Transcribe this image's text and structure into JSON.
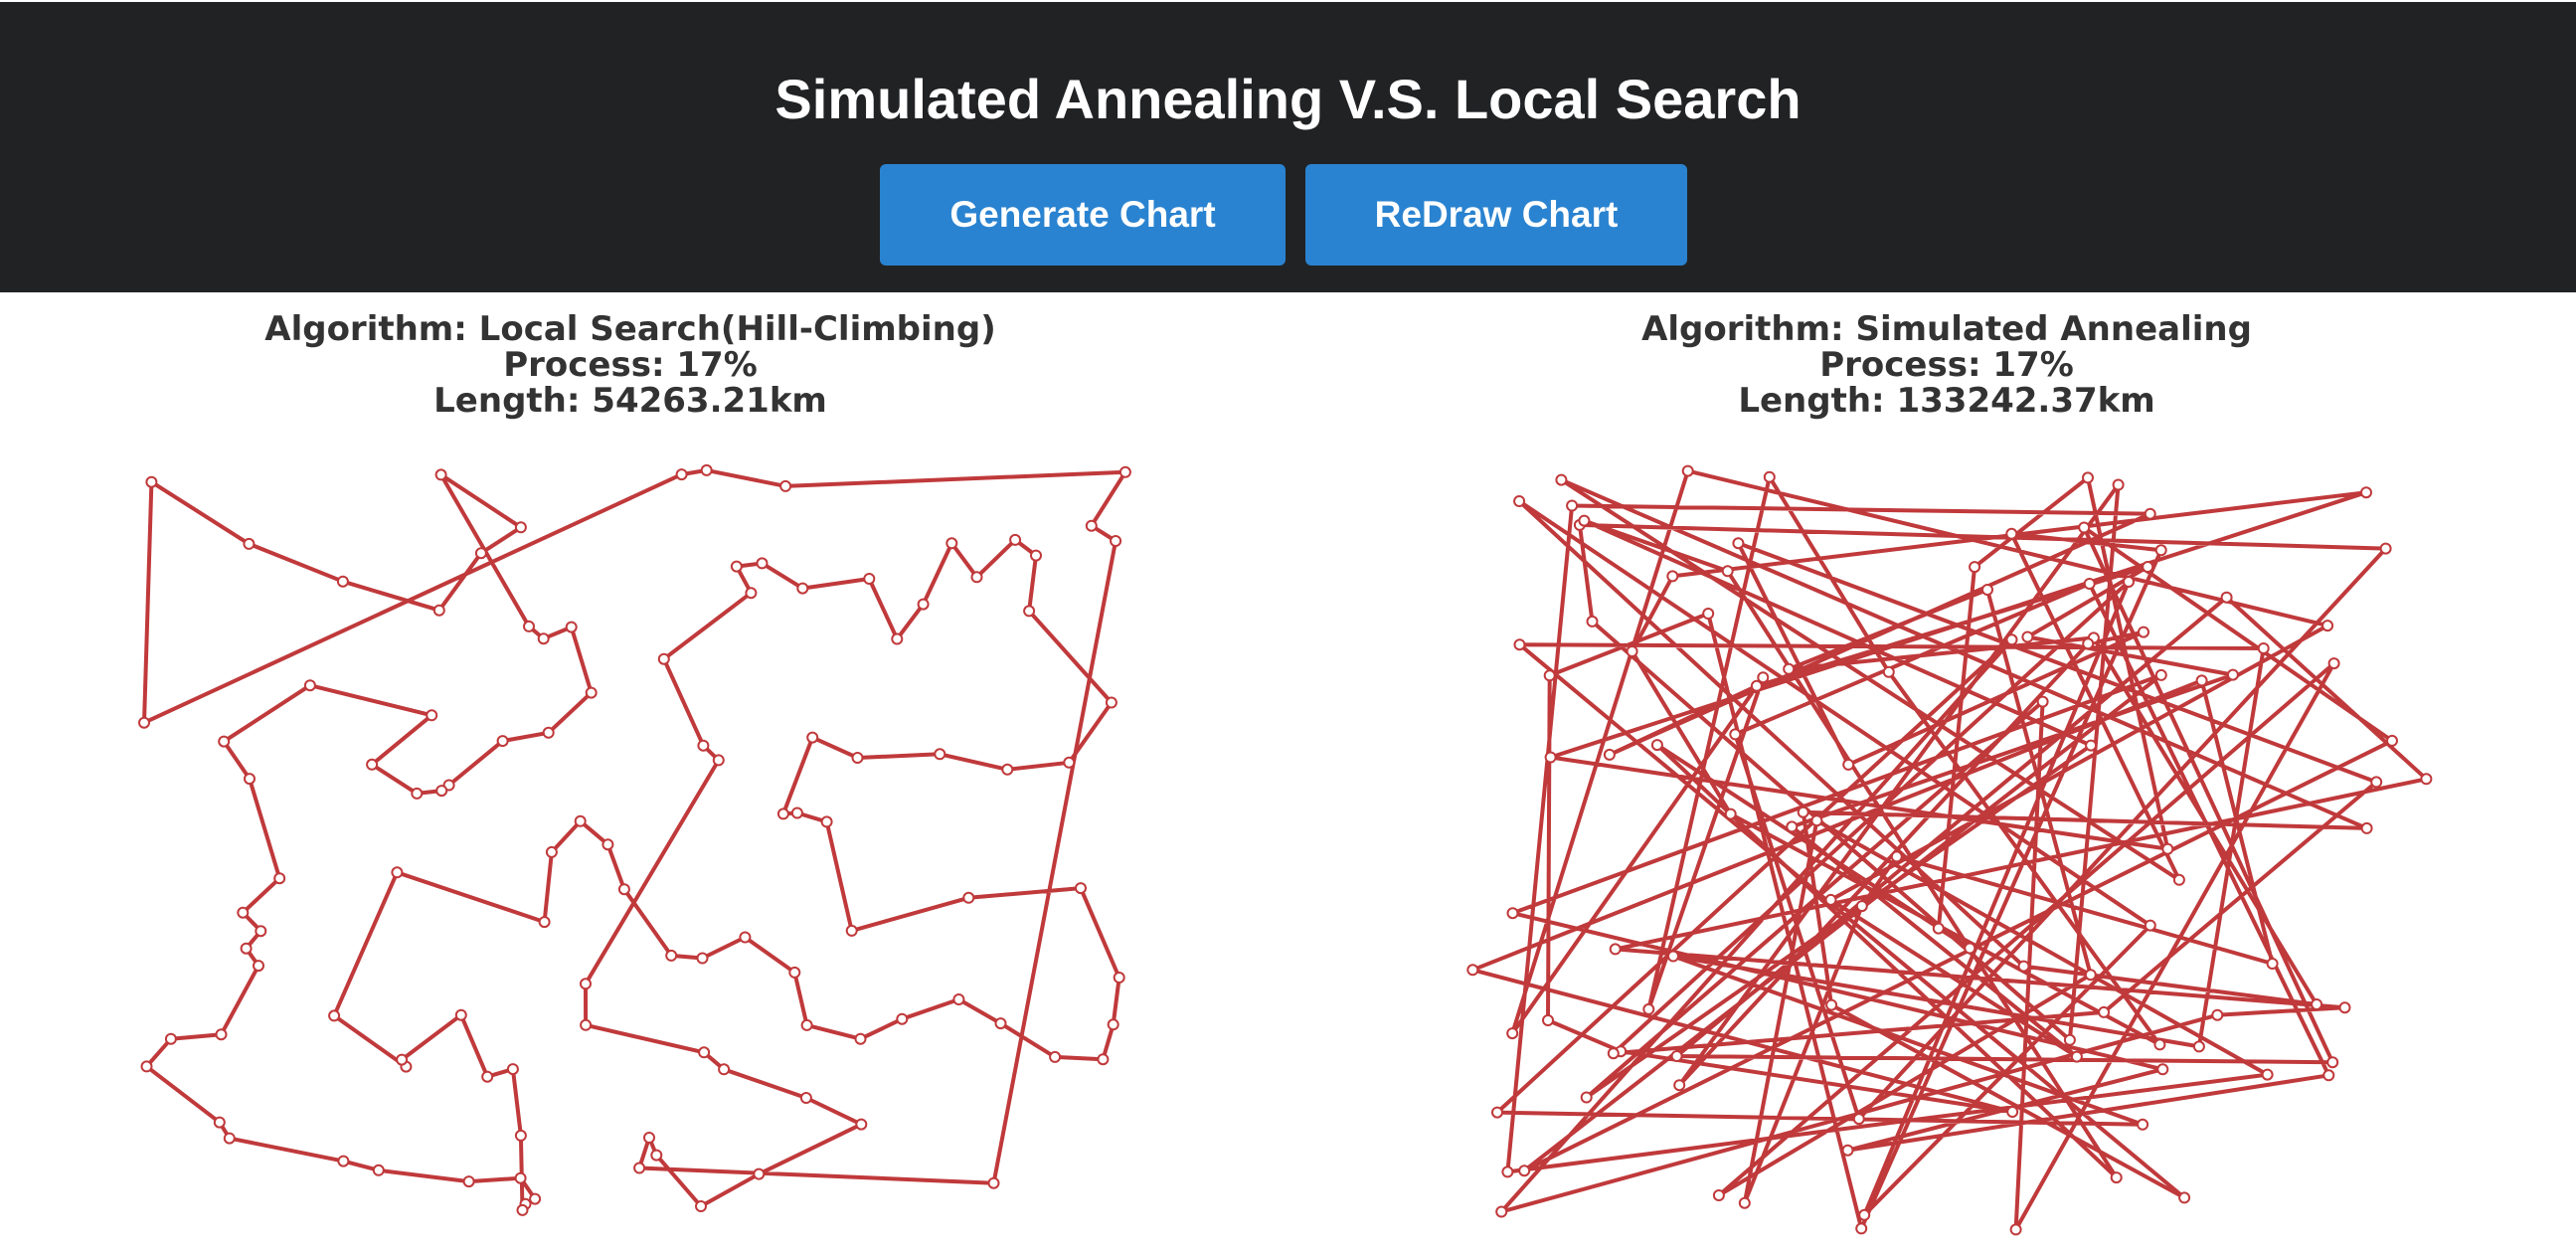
{
  "header": {
    "title": "Simulated Annealing V.S. Local Search",
    "generate_label": "Generate Chart",
    "redraw_label": "ReDraw Chart"
  },
  "colors": {
    "header_bg": "#212224",
    "button_bg": "#2a83d0",
    "route": "#c0393b",
    "city_fill": "#ffffff"
  },
  "panels": [
    {
      "algorithm": "Algorithm: Local Search(Hill-Climbing)",
      "process": "Process: 17%",
      "length": "Length: 54263.21km"
    },
    {
      "algorithm": "Algorithm: Simulated Annealing",
      "process": "Process: 17%",
      "length": "Length: 133242.37km"
    }
  ]
}
